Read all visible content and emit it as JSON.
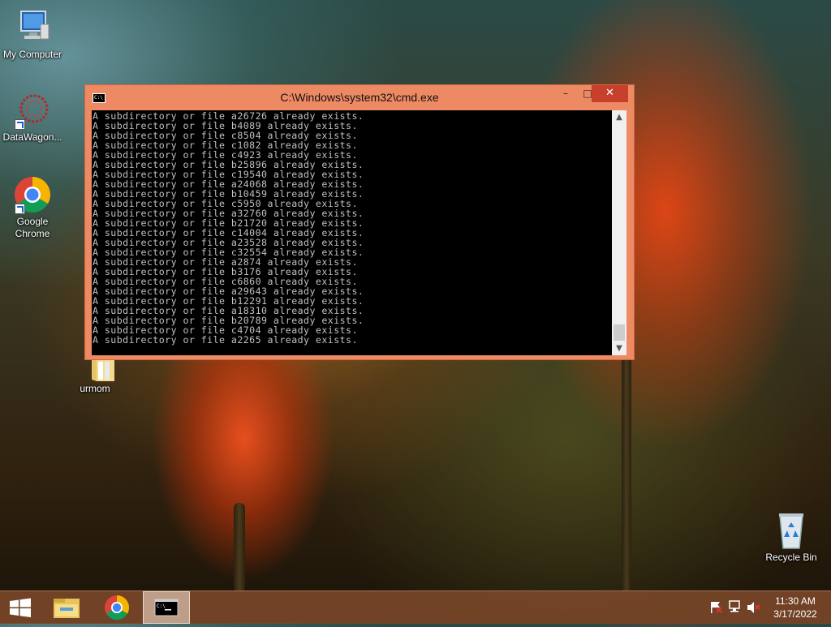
{
  "desktop": {
    "icons": [
      {
        "label": "My Computer",
        "icon": "computer-icon"
      },
      {
        "label": "DataWagon...",
        "icon": "datawagon-icon"
      },
      {
        "label": "Google Chrome",
        "icon": "chrome-icon"
      },
      {
        "label": "urmom",
        "icon": "folder-icon"
      },
      {
        "label": "Recycle Bin",
        "icon": "recycle-bin-icon"
      }
    ]
  },
  "window": {
    "title": "C:\\Windows\\system32\\cmd.exe",
    "minimize_glyph": "–",
    "maximize_glyph": "□",
    "close_glyph": "✕",
    "lines": [
      "A subdirectory or file a26726 already exists.",
      "A subdirectory or file b4089 already exists.",
      "A subdirectory or file c8504 already exists.",
      "A subdirectory or file c1082 already exists.",
      "A subdirectory or file c4923 already exists.",
      "A subdirectory or file b25896 already exists.",
      "A subdirectory or file c19540 already exists.",
      "A subdirectory or file a24068 already exists.",
      "A subdirectory or file b10459 already exists.",
      "A subdirectory or file c5950 already exists.",
      "A subdirectory or file a32760 already exists.",
      "A subdirectory or file b21720 already exists.",
      "A subdirectory or file c14004 already exists.",
      "A subdirectory or file a23528 already exists.",
      "A subdirectory or file c32554 already exists.",
      "A subdirectory or file a2874 already exists.",
      "A subdirectory or file b3176 already exists.",
      "A subdirectory or file c6860 already exists.",
      "A subdirectory or file a29643 already exists.",
      "A subdirectory or file b12291 already exists.",
      "A subdirectory or file a18310 already exists.",
      "A subdirectory or file b20789 already exists.",
      "A subdirectory or file c4704 already exists.",
      "A subdirectory or file a2265 already exists."
    ]
  },
  "taskbar": {
    "items": [
      {
        "icon": "windows-start-icon"
      },
      {
        "icon": "file-explorer-icon"
      },
      {
        "icon": "chrome-icon"
      },
      {
        "icon": "cmd-icon"
      }
    ],
    "tray_icons": [
      "action-center-flag-icon",
      "network-icon",
      "volume-muted-icon"
    ],
    "time": "11:30 AM",
    "date": "3/17/2022"
  },
  "colors": {
    "window_frame": "#ee8a63",
    "close_button": "#c7402b",
    "console_bg": "#000000",
    "console_text": "#c0c0c0"
  }
}
